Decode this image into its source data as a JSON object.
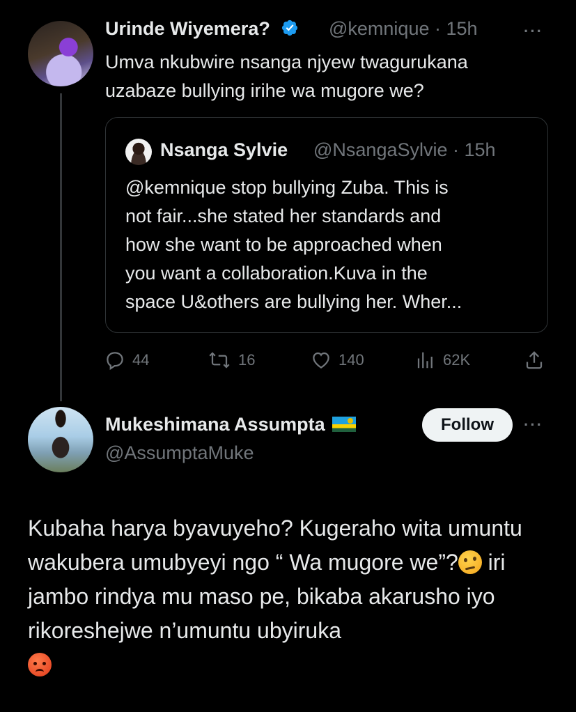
{
  "tweet": {
    "author_name": "Urinde Wiyemera?",
    "handle": "@kemnique",
    "time": "· 15h",
    "more_label": "···",
    "text_lines": [
      "Umva nkubwire nsanga njyew twagurukana",
      "uzabaze bullying irihe wa mugore we?"
    ],
    "quote": {
      "author_name": "Nsanga Sylvie",
      "handle": "@NsangaSylvie",
      "time": "· 15h",
      "text_lines": [
        "@kemnique stop bullying Zuba. This is",
        "not fair...she stated her standards and",
        "how she want to be approached when",
        "you want a collaboration.Kuva in the",
        "space U&others are bullying her. Wher..."
      ]
    },
    "actions": {
      "replies": "44",
      "retweets": "16",
      "likes": "140",
      "views": "62K"
    }
  },
  "reply": {
    "author_name": "Mukeshimana Assumpta",
    "handle": "@AssumptaMuke",
    "follow_label": "Follow",
    "more_label": "···",
    "text_part1": "Kubaha harya byavuyeho? Kugeraho wita umuntu wakubera umubyeyi ngo “ Wa mugore we”?",
    "text_part2": " iri jambo rindya mu maso pe, bikaba akarusho iyo rikoreshejwe n’umuntu ubyiruka",
    "emojis": [
      "thinking-face",
      "angry-face"
    ]
  },
  "colors": {
    "background": "#000000",
    "text": "#e7e9ea",
    "secondary": "#71767b",
    "verified": "#1d9bf0",
    "follow_bg": "#eff3f4"
  }
}
